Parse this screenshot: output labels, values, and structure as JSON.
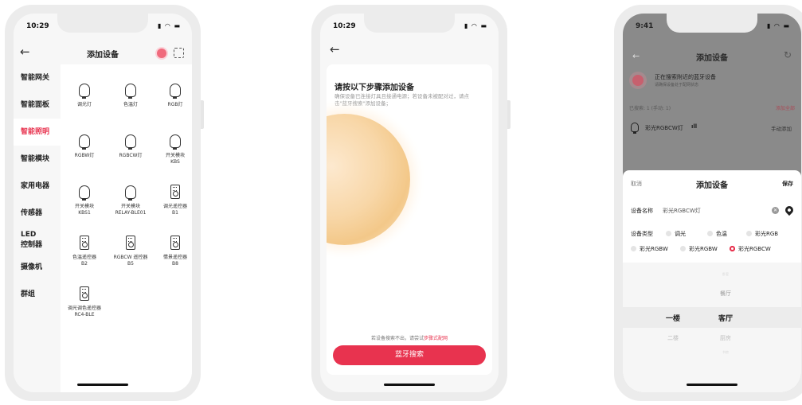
{
  "phone1": {
    "time": "10:29",
    "title": "添加设备",
    "back_icon": "arrow-left-icon",
    "categories": [
      "智能网关",
      "智能面板",
      "智能照明",
      "智能模块",
      "家用电器",
      "传感器",
      "LED\n控制器",
      "摄像机",
      "群组"
    ],
    "active_category": "智能照明",
    "devices": [
      {
        "label": "调光灯",
        "icon": "bulb-icon"
      },
      {
        "label": "色温灯",
        "icon": "bulb-icon"
      },
      {
        "label": "RGB灯",
        "icon": "bulb-icon"
      },
      {
        "label": "RGBW灯",
        "icon": "bulb-icon"
      },
      {
        "label": "RGBCW灯",
        "icon": "bulb-icon"
      },
      {
        "label": "开关模块\nKBS",
        "icon": "bulb-icon"
      },
      {
        "label": "开关模块\nKBS1",
        "icon": "bulb-icon"
      },
      {
        "label": "开关模块\nRELAY-BLE01",
        "icon": "bulb-icon"
      },
      {
        "label": "调光遥控器\nB1",
        "icon": "remote-icon"
      },
      {
        "label": "色温遥控器\nB2",
        "icon": "remote-icon"
      },
      {
        "label": "RGBCW 遥控器\nB5",
        "icon": "remote-icon"
      },
      {
        "label": "情景遥控器\nB8",
        "icon": "remote-icon"
      },
      {
        "label": "调光调色遥控器\nRC4-BLE",
        "icon": "remote-icon"
      }
    ]
  },
  "phone2": {
    "time": "10:29",
    "heading": "请按以下步骤添加设备",
    "desc": "确保设备已连接灯具且接通电源；若设备未被配对过，请点击\"蓝牙搜索\"添加设备；",
    "hint_prefix": "若设备搜索不出，请尝试",
    "hint_link": "步骤式配网",
    "button": "蓝牙搜索"
  },
  "phone3": {
    "time": "9:41",
    "title": "添加设备",
    "searching": "正在搜索附近的蓝牙设备",
    "searching_sub": "请确保设备处于配网状态",
    "found": "已搜索: 1 (手动: 1)",
    "add_all": "添加全部",
    "device_name": "彩光RGBCW灯",
    "signal": "ıll",
    "manual_add": "手动添加",
    "sheet": {
      "cancel": "取消",
      "title": "添加设备",
      "save": "保存",
      "name_label": "设备名称",
      "name_value": "彩光RGBCW灯",
      "type_label": "设备类型",
      "types_row1": [
        "调光",
        "色温",
        "彩光RGB"
      ],
      "types_row2": [
        "彩光RGBW",
        "彩光RGBW",
        "彩光RGBCW"
      ],
      "selected_type": "彩光RGBCW",
      "picker_left": [
        "一楼",
        "二楼"
      ],
      "picker_right": [
        "餐厅",
        "客厅",
        "厨房"
      ],
      "picker_top_tiny": "卧室",
      "picker_bottom_tiny": "书房"
    }
  },
  "colors": {
    "accent": "#e8334f"
  }
}
